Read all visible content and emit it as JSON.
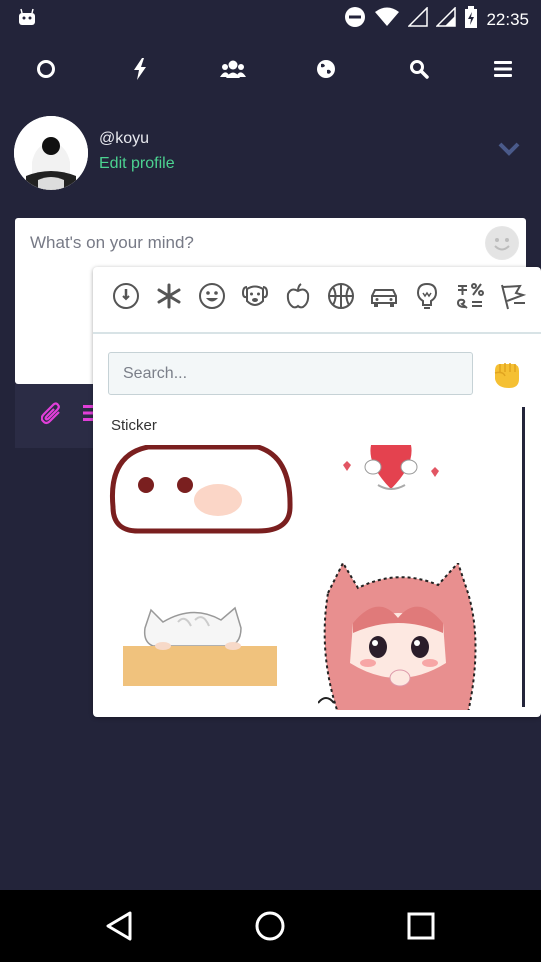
{
  "status_bar": {
    "time": "22:35",
    "icons": [
      "android-icon",
      "dnd-icon",
      "wifi-icon",
      "signal-icon",
      "signal-icon",
      "battery-charging-icon"
    ]
  },
  "top_nav": {
    "items": [
      "circle-icon",
      "bolt-icon",
      "users-icon",
      "globe-icon",
      "search-icon",
      "menu-icon"
    ]
  },
  "profile": {
    "username": "@koyu",
    "edit_label": "Edit profile"
  },
  "composer": {
    "placeholder": "What's on your mind?"
  },
  "emoji_picker": {
    "categories": [
      "clock-icon",
      "asterisk-icon",
      "smile-icon",
      "dog-icon",
      "apple-icon",
      "basketball-icon",
      "car-icon",
      "lightbulb-icon",
      "symbols-icon",
      "flag-icon"
    ],
    "search_placeholder": "Search...",
    "section_label": "Sticker",
    "stickers": [
      "blob-face-sticker",
      "heart-hug-sticker",
      "cat-peek-sticker",
      "anime-girl-sticker"
    ]
  },
  "colors": {
    "background": "#23243a",
    "accent_green": "#4cd291",
    "accent_pink": "#e13fd9"
  }
}
